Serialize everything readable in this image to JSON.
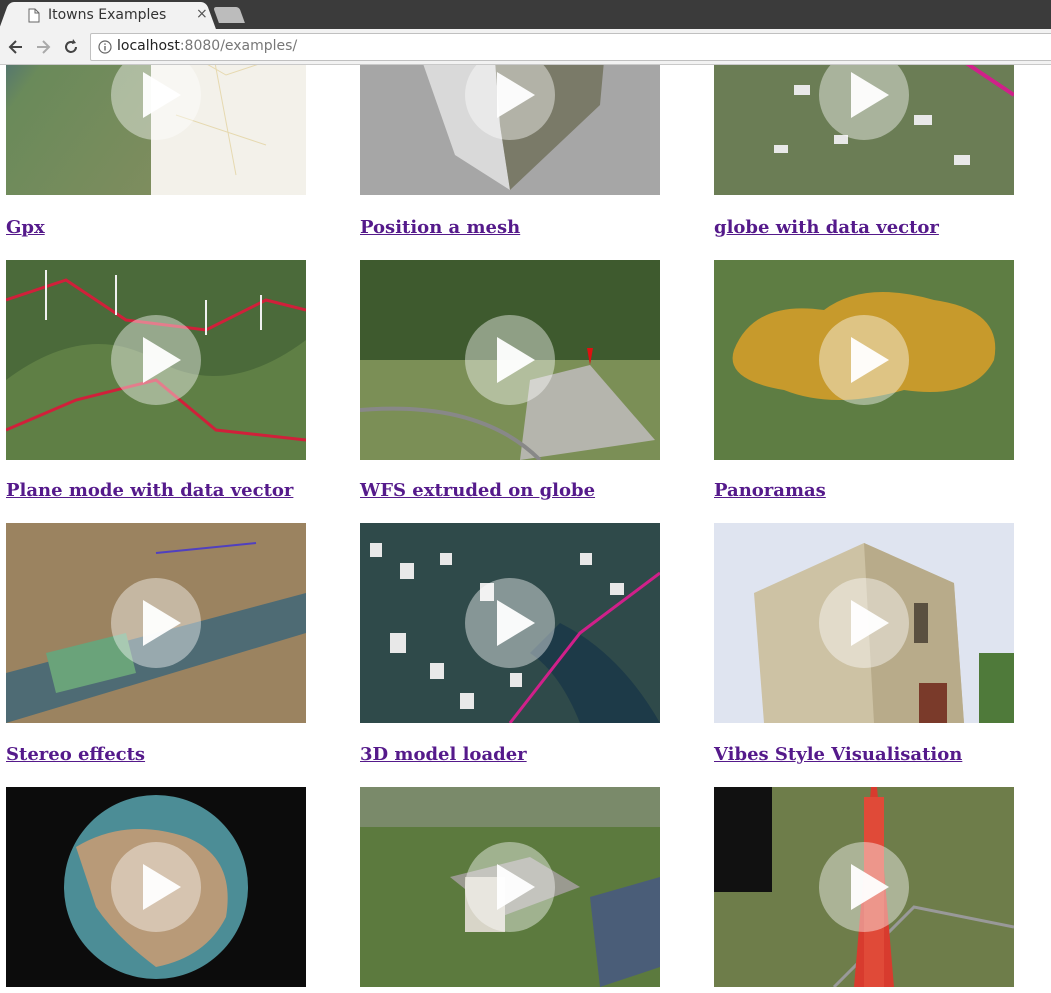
{
  "browser": {
    "tab_title": "Itowns Examples",
    "tab_close": "×",
    "url_host": "localhost",
    "url_rest": ":8080/examples/"
  },
  "examples": [
    {
      "title": "",
      "art": "map"
    },
    {
      "title": "",
      "art": "mesh"
    },
    {
      "title": "",
      "art": "town"
    },
    {
      "title": "Gpx",
      "art": "gpx"
    },
    {
      "title": "Position a mesh",
      "art": "peak"
    },
    {
      "title": "globe with data vector",
      "art": "yellow"
    },
    {
      "title": "Plane mode with data vector",
      "art": "plane"
    },
    {
      "title": "WFS extruded on globe",
      "art": "city"
    },
    {
      "title": "Panoramas",
      "art": "church"
    },
    {
      "title": "Stereo effects",
      "art": "globe"
    },
    {
      "title": "3D model loader",
      "art": "building"
    },
    {
      "title": "Vibes Style Visualisation",
      "art": "tower"
    }
  ]
}
